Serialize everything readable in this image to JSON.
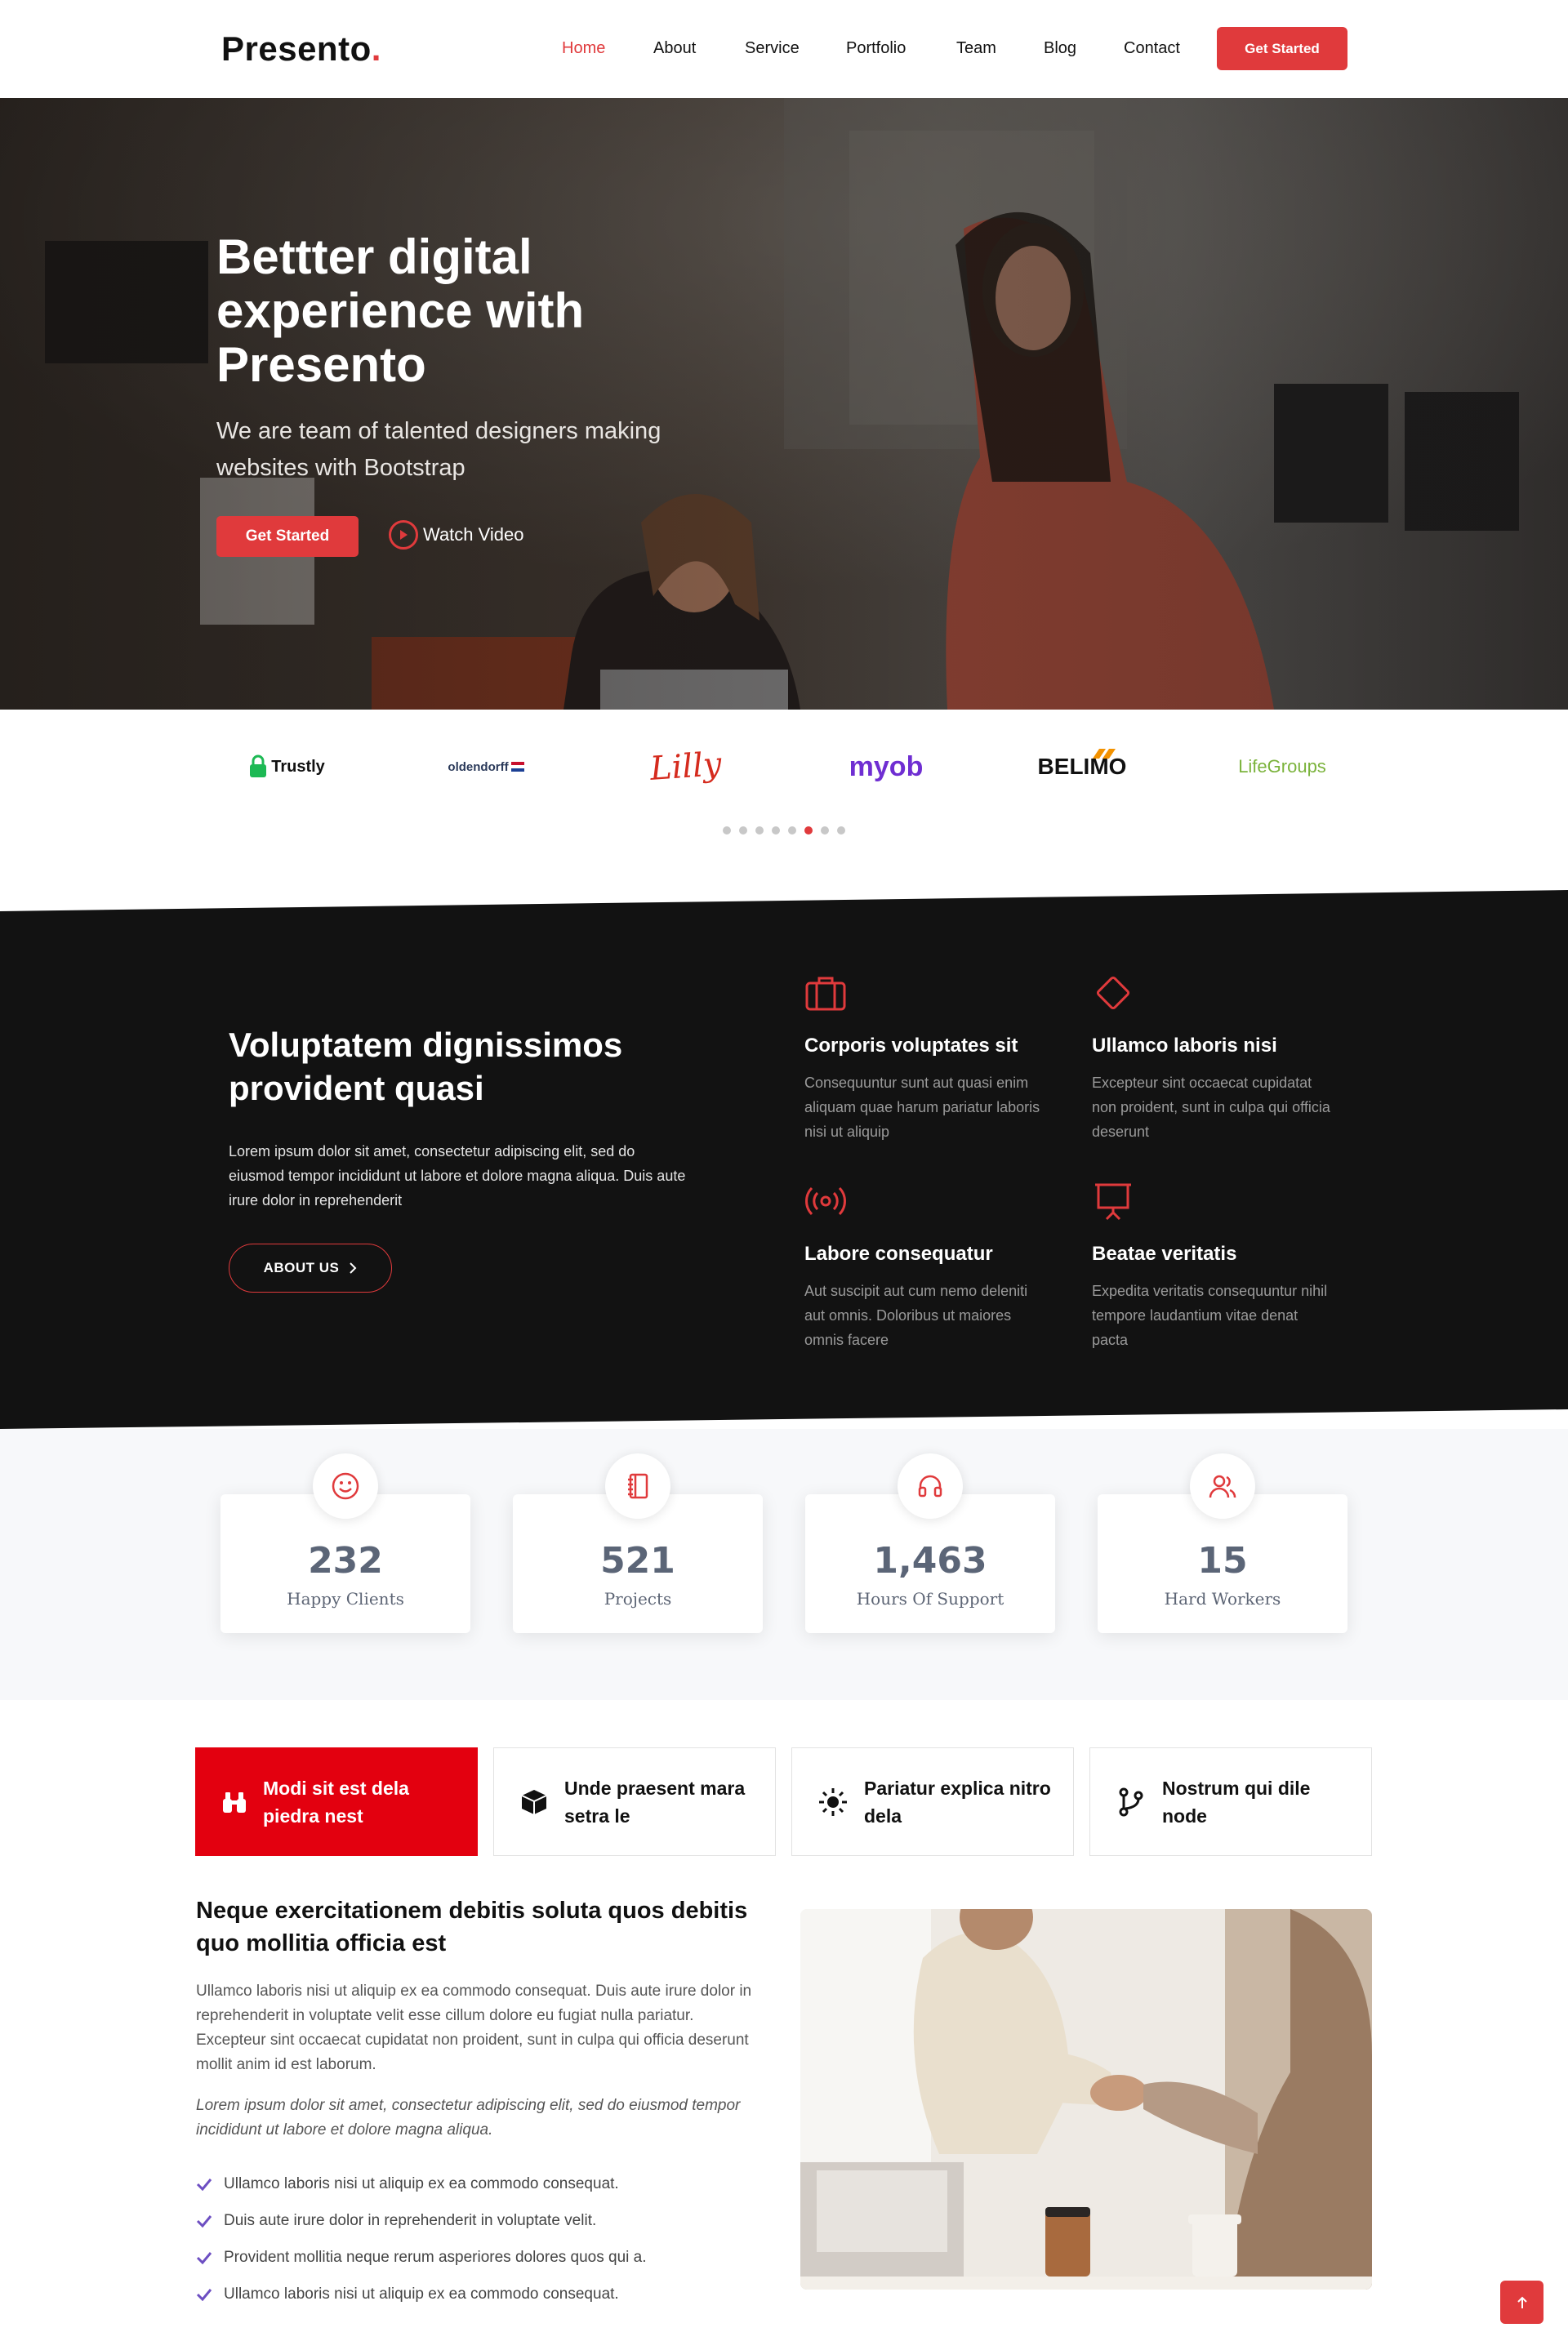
{
  "brand": {
    "name": "Presento",
    "dot": "."
  },
  "nav": {
    "items": [
      {
        "label": "Home"
      },
      {
        "label": "About"
      },
      {
        "label": "Service"
      },
      {
        "label": "Portfolio"
      },
      {
        "label": "Team"
      },
      {
        "label": "Blog"
      },
      {
        "label": "Contact"
      }
    ],
    "active": "Home",
    "cta": "Get Started"
  },
  "hero": {
    "title": "Bettter digital experience with Presento",
    "subtitle": "We are team of talented designers making websites with Bootstrap",
    "cta": "Get Started",
    "video_link": "Watch Video"
  },
  "clients": {
    "logos": [
      "Trustly",
      "oldendorff",
      "Lilly",
      "myob",
      "BELIMO",
      "LifeGroups"
    ],
    "pagination": {
      "count": 8,
      "active_index": 5
    }
  },
  "about": {
    "title": "Voluptatem dignissimos provident quasi",
    "text": "Lorem ipsum dolor sit amet, consectetur adipiscing elit, sed do eiusmod tempor incididunt ut labore et dolore magna aliqua. Duis aute irure dolor in reprehenderit",
    "button": "ABOUT US",
    "features": [
      {
        "icon": "briefcase-icon",
        "title": "Corporis voluptates sit",
        "text": "Consequuntur sunt aut quasi enim aliquam quae harum pariatur laboris nisi ut aliquip"
      },
      {
        "icon": "diamond-icon",
        "title": "Ullamco laboris nisi",
        "text": "Excepteur sint occaecat cupidatat non proident, sunt in culpa qui officia deserunt"
      },
      {
        "icon": "broadcast-icon",
        "title": "Labore consequatur",
        "text": "Aut suscipit aut cum nemo deleniti aut omnis. Doloribus ut maiores omnis facere"
      },
      {
        "icon": "easel-icon",
        "title": "Beatae veritatis",
        "text": "Expedita veritatis consequuntur nihil tempore laudantium vitae denat pacta"
      }
    ]
  },
  "stats": [
    {
      "icon": "emoji-smile-icon",
      "value": "232",
      "label": "Happy Clients"
    },
    {
      "icon": "journal-icon",
      "value": "521",
      "label": "Projects"
    },
    {
      "icon": "headset-icon",
      "value": "1,463",
      "label": "Hours Of Support"
    },
    {
      "icon": "people-icon",
      "value": "15",
      "label": "Hard Workers"
    }
  ],
  "tabs": [
    {
      "icon": "binoculars-icon",
      "label": "Modi sit est dela piedra nest",
      "active": true
    },
    {
      "icon": "box-icon",
      "label": "Unde praesent mara setra le",
      "active": false
    },
    {
      "icon": "sun-icon",
      "label": "Pariatur explica nitro dela",
      "active": false
    },
    {
      "icon": "git-branch-icon",
      "label": "Nostrum qui dile node",
      "active": false
    }
  ],
  "details": {
    "title": "Neque exercitationem debitis soluta quos debitis quo mollitia officia est",
    "text": "Ullamco laboris nisi ut aliquip ex ea commodo consequat. Duis aute irure dolor in reprehenderit in voluptate velit esse cillum dolore eu fugiat nulla pariatur. Excepteur sint occaecat cupidatat non proident, sunt in culpa qui officia deserunt mollit anim id est laborum.",
    "italic": "Lorem ipsum dolor sit amet, consectetur adipiscing elit, sed do eiusmod tempor incididunt ut labore et dolore magna aliqua.",
    "list": [
      "Ullamco laboris nisi ut aliquip ex ea commodo consequat.",
      "Duis aute irure dolor in reprehenderit in voluptate velit.",
      "Provident mollitia neque rerum asperiores dolores quos qui a.",
      "Ullamco laboris nisi ut aliquip ex ea commodo consequat."
    ]
  },
  "colors": {
    "accent": "#e03a3c",
    "tab_active": "#e3000f",
    "dark": "#121212",
    "check": "#6d4fc2"
  },
  "back_to_top": "arrow-up-icon"
}
